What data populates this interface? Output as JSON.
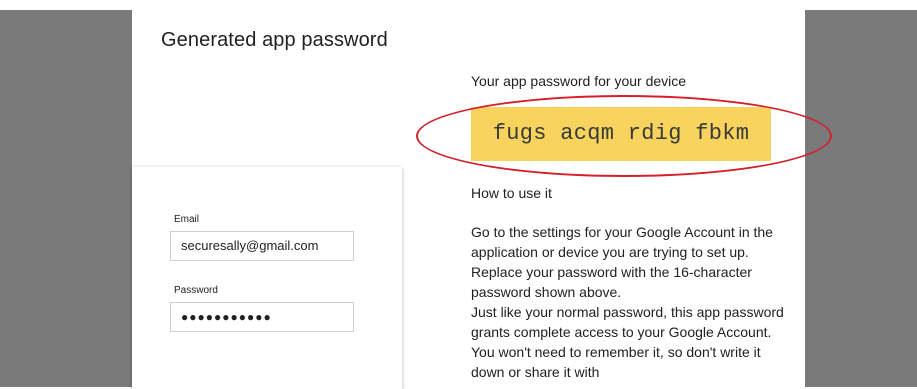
{
  "dialog": {
    "title": "Generated app password"
  },
  "login_card": {
    "email_label": "Email",
    "email_value": "securesally@gmail.com",
    "password_label": "Password",
    "password_value": "●●●●●●●●●●●"
  },
  "app_password": {
    "heading": "Your app password for your device",
    "value": "fugs acqm rdig fbkm"
  },
  "how_to": {
    "heading": "How to use it",
    "paragraph1": "Go to the settings for your Google Account in the application or device you are trying to set up. Replace your password with the 16-character password shown above.",
    "paragraph2": "Just like your normal password, this app password grants complete access to your Google Account. You won't need to remember it, so don't write it down or share it with"
  },
  "colors": {
    "password_highlight": "#f8d35e",
    "annotation_ellipse": "#d4202b",
    "backdrop_shade": "#7a7a7a"
  }
}
